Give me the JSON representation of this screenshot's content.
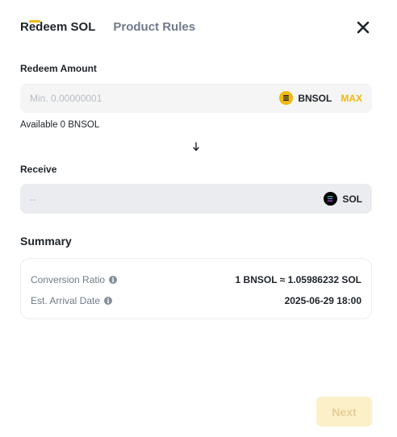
{
  "tabs": [
    {
      "label": "Redeem SOL",
      "active": true
    },
    {
      "label": "Product Rules",
      "active": false
    }
  ],
  "icons": {
    "close": "close-icon",
    "arrow": "arrow-down-icon",
    "bnsol": "bnsol-coin-icon",
    "sol": "sol-coin-icon",
    "info": "info-icon"
  },
  "redeem": {
    "label": "Redeem Amount",
    "placeholder": "Min. 0.00000001",
    "value": "",
    "coin": "BNSOL",
    "max_label": "MAX",
    "available": "Available 0 BNSOL"
  },
  "receive": {
    "label": "Receive",
    "value": "--",
    "coin": "SOL"
  },
  "summary": {
    "title": "Summary",
    "rows": [
      {
        "label": "Conversion Ratio",
        "value": "1 BNSOL ≈ 1.05986232 SOL"
      },
      {
        "label": "Est. Arrival Date",
        "value": "2025-06-29 18:00"
      }
    ]
  },
  "actions": {
    "next_label": "Next"
  },
  "colors": {
    "accent": "#f0b90b",
    "text_primary": "#1e2329",
    "text_secondary": "#707a8a",
    "field_bg": "#f5f5f5",
    "button_disabled_bg": "#fcf0c9"
  }
}
